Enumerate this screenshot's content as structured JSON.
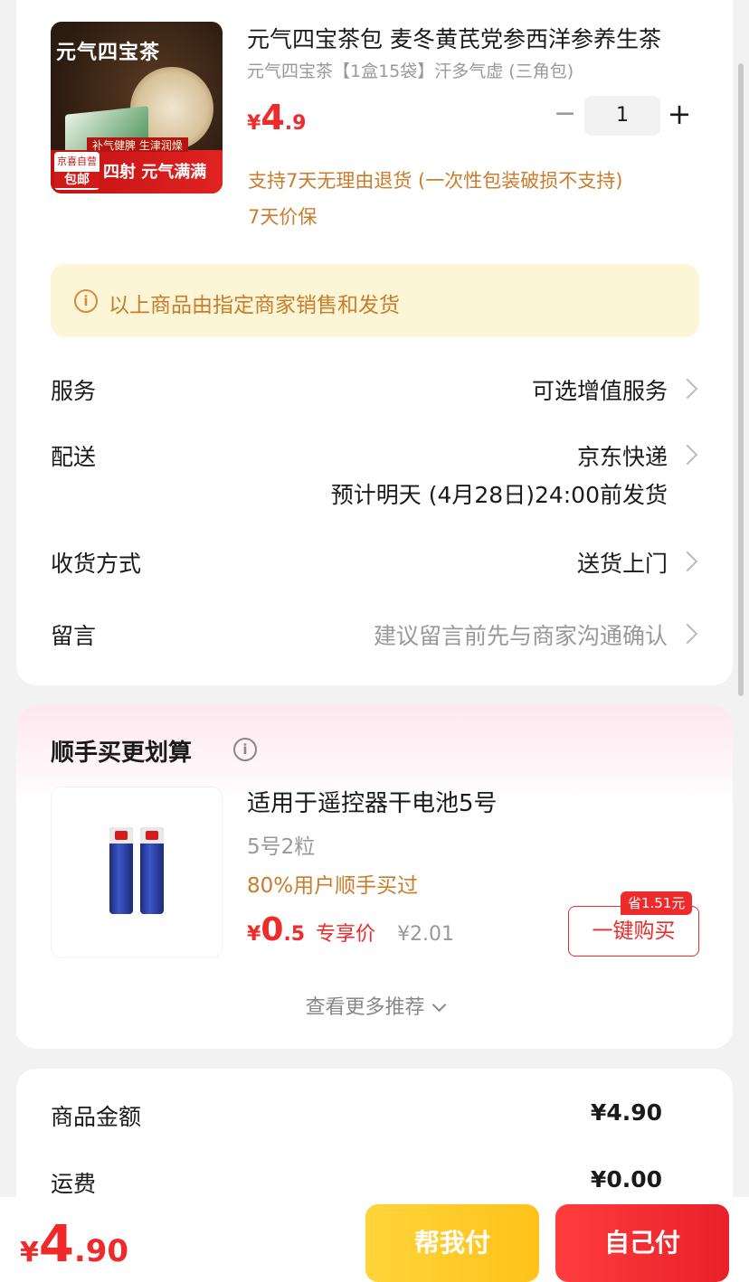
{
  "product": {
    "image_title": "元气四宝茶",
    "image_tagline": "补气健脾 生津润燥",
    "image_badge_top": "京喜自营",
    "image_badge_bottom": "包邮",
    "image_slogan": "四射 元气满满",
    "title": "元气四宝茶包 麦冬黄芪党参西洋参养生茶",
    "spec": "元气四宝茶【1盒15袋】汗多气虚 (三角包)",
    "price_currency": "¥",
    "price_int": "4",
    "price_dec": ".9",
    "quantity": "1",
    "minus": "−",
    "plus": "+",
    "guarantee_1": "支持7天无理由退货 (一次性包装破损不支持)",
    "guarantee_2": "7天价保"
  },
  "notice": {
    "icon": "i",
    "text": "以上商品由指定商家销售和发货"
  },
  "rows": {
    "service_label": "服务",
    "service_value": "可选增值服务",
    "delivery_label": "配送",
    "delivery_value": "京东快递",
    "delivery_eta": "预计明天 (4月28日)24:00前发货",
    "receive_label": "收货方式",
    "receive_value": "送货上门",
    "message_label": "留言",
    "message_placeholder": "建议留言前先与商家沟通确认"
  },
  "addon": {
    "section_title": "顺手买更划算",
    "info_icon": "i",
    "item_title": "适用于遥控器干电池5号",
    "item_spec": "5号2粒",
    "item_popularity": "80%用户顺手买过",
    "price_currency": "¥",
    "price_int": "0",
    "price_dec": ".5",
    "price_label": "专享价",
    "orig_price": "¥2.01",
    "save_tag": "省1.51元",
    "buy_button": "一键购买",
    "more_text": "查看更多推荐"
  },
  "summary": {
    "goods_label": "商品金额",
    "goods_value": "¥4.90",
    "shipping_label": "运费",
    "shipping_value": "¥0.00"
  },
  "footer": {
    "total_currency": "¥",
    "total_int": "4",
    "total_dec": ".90",
    "help_pay": "帮我付",
    "self_pay": "自己付"
  },
  "colors": {
    "accent_red": "#ee2a2a",
    "accent_orange": "#c97c2b",
    "notice_bg": "#fdf6d6",
    "help_btn": "#ffc21a"
  }
}
